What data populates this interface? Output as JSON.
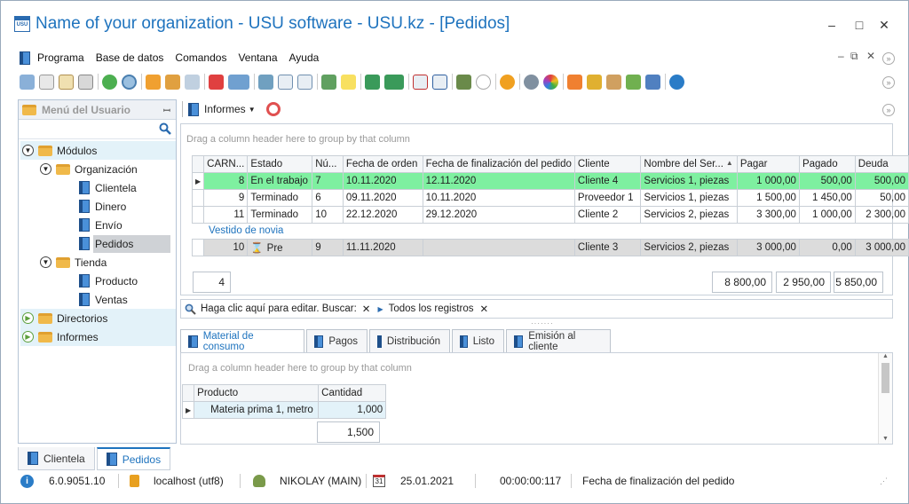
{
  "window": {
    "title": "Name of your organization - USU software - USU.kz - [Pedidos]",
    "logo_text": "USU",
    "minimize": "–",
    "maximize": "□",
    "close": "✕"
  },
  "menu": [
    "Programa",
    "Base de datos",
    "Comandos",
    "Ventana",
    "Ayuda"
  ],
  "sidebar": {
    "header": "Menú del Usuario",
    "items": [
      {
        "label": "Módulos",
        "level": 0,
        "type": "folder",
        "expander": "down"
      },
      {
        "label": "Organización",
        "level": 1,
        "type": "folder",
        "expander": "down"
      },
      {
        "label": "Clientela",
        "level": 2,
        "type": "leaf"
      },
      {
        "label": "Dinero",
        "level": 2,
        "type": "leaf"
      },
      {
        "label": "Envío",
        "level": 2,
        "type": "leaf"
      },
      {
        "label": "Pedidos",
        "level": 2,
        "type": "leaf",
        "selected": true
      },
      {
        "label": "Tienda",
        "level": 1,
        "type": "folder",
        "expander": "down"
      },
      {
        "label": "Producto",
        "level": 2,
        "type": "leaf"
      },
      {
        "label": "Ventas",
        "level": 2,
        "type": "leaf"
      },
      {
        "label": "Directorios",
        "level": 0,
        "type": "folder",
        "expander": "right"
      },
      {
        "label": "Informes",
        "level": 0,
        "type": "folder",
        "expander": "right"
      }
    ]
  },
  "reports_button": "Informes",
  "main_grid": {
    "group_hint": "Drag a column header here to group by that column",
    "columns": [
      "CARN...",
      "Estado",
      "Nú...",
      "Fecha de orden",
      "Fecha de finalización del pedido",
      "Cliente",
      "Nombre del Ser...",
      "Pagar",
      "Pagado",
      "Deuda"
    ],
    "rows": [
      [
        "8",
        "En el trabajo",
        "7",
        "10.11.2020",
        "12.11.2020",
        "Cliente 4",
        "Servicios 1, piezas",
        "1 000,00",
        "500,00",
        "500,00"
      ],
      [
        "9",
        "Terminado",
        "6",
        "09.11.2020",
        "10.11.2020",
        "Proveedor 1",
        "Servicios 1, piezas",
        "1 500,00",
        "1 450,00",
        "50,00"
      ],
      [
        "11",
        "Terminado",
        "10",
        "22.12.2020",
        "29.12.2020",
        "Cliente 2",
        "Servicios 2, piezas",
        "3 300,00",
        "1 000,00",
        "2 300,00"
      ]
    ],
    "group_label": "Vestido de novia",
    "group_rows": [
      [
        "10",
        "Pre",
        "9",
        "11.11.2020",
        "",
        "Cliente 3",
        "Servicios 2, piezas",
        "3 000,00",
        "0,00",
        "3 000,00"
      ]
    ],
    "footer": {
      "count": "4",
      "pagar": "8 800,00",
      "pagado": "2 950,00",
      "deuda": "5 850,00"
    }
  },
  "filter_bar": {
    "text": "Haga clic aquí para editar. Buscar:",
    "all_records": "Todos los registros",
    "clear": "✕"
  },
  "detail_tabs": [
    "Material de consumo",
    "Pagos",
    "Distribución",
    "Listo",
    "Emisión al cliente"
  ],
  "detail_grid": {
    "group_hint": "Drag a column header here to group by that column",
    "columns": [
      "Producto",
      "Cantidad"
    ],
    "rows": [
      [
        "Materia prima 1, metro",
        "1,000"
      ]
    ],
    "total": "1,500"
  },
  "window_tabs": [
    "Clientela",
    "Pedidos"
  ],
  "status": {
    "version": "6.0.9051.10",
    "server": "localhost (utf8)",
    "user": "NIKOLAY (MAIN)",
    "date": "25.01.2021",
    "calendar_day": "31",
    "timer": "00:00:00:117",
    "hint": "Fecha de finalización del pedido"
  }
}
